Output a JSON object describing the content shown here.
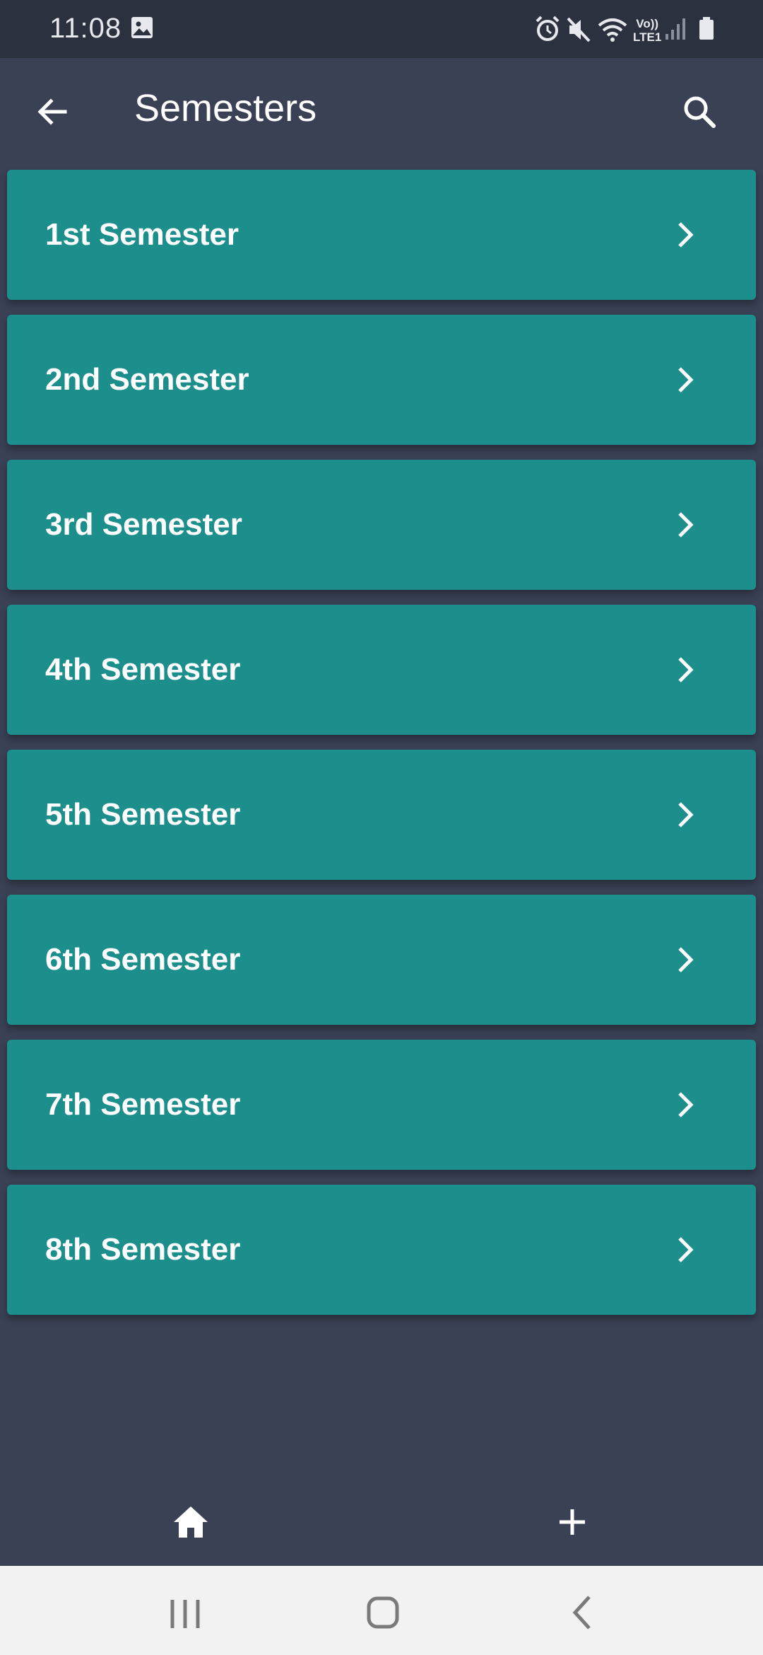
{
  "status_bar": {
    "time": "11:08",
    "lte_line1": "Vo))",
    "lte_line2": "LTE1",
    "icons": [
      "image-icon",
      "alarm-icon",
      "mute-icon",
      "wifi-icon",
      "signal-icon",
      "battery-icon"
    ]
  },
  "app_bar": {
    "title": "Semesters",
    "back_icon": "arrow-left-icon",
    "search_icon": "search-icon"
  },
  "semesters": [
    {
      "label": "1st Semester"
    },
    {
      "label": "2nd Semester"
    },
    {
      "label": "3rd Semester"
    },
    {
      "label": "4th Semester"
    },
    {
      "label": "5th Semester"
    },
    {
      "label": "6th Semester"
    },
    {
      "label": "7th Semester"
    },
    {
      "label": "8th Semester"
    }
  ],
  "bottom_bar": {
    "items": [
      "home-icon",
      "plus-icon"
    ]
  },
  "colors": {
    "background": "#3a4155",
    "status_bar": "#2c3140",
    "card": "#1c8e8b",
    "nav_bar": "#f2f2f2"
  }
}
